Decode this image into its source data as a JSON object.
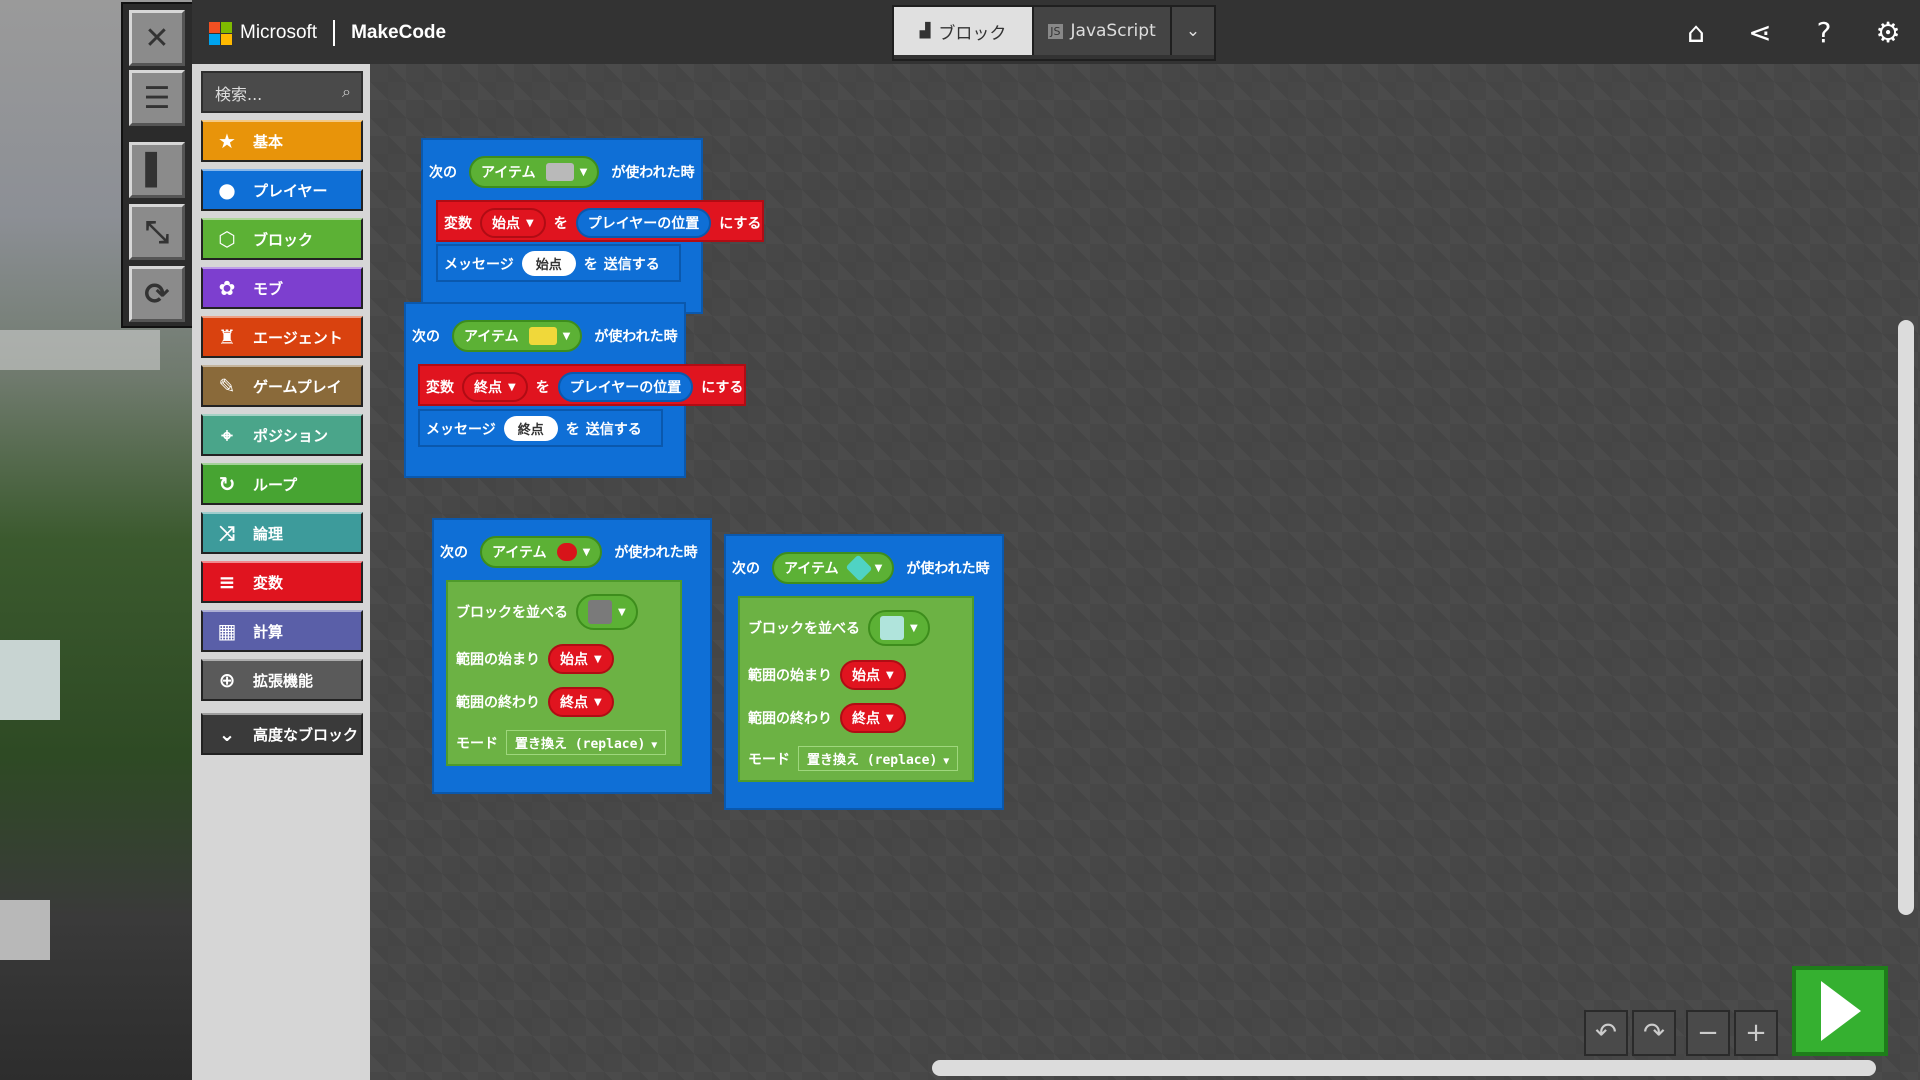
{
  "topbar": {
    "brand": "Microsoft",
    "product": "MakeCode",
    "mode_blocks": "ブロック",
    "mode_js": "JavaScript",
    "icons": [
      "home-icon",
      "share-icon",
      "help-icon",
      "settings-icon"
    ]
  },
  "toolbox": {
    "search_placeholder": "検索...",
    "categories": [
      {
        "label": "基本",
        "color": "#e8940a",
        "icon": "star-icon"
      },
      {
        "label": "プレイヤー",
        "color": "#0f6fd6",
        "icon": "player-icon"
      },
      {
        "label": "ブロック",
        "color": "#5cb135",
        "icon": "cube-icon"
      },
      {
        "label": "モブ",
        "color": "#7d3fcf",
        "icon": "paw-icon"
      },
      {
        "label": "エージェント",
        "color": "#d9420f",
        "icon": "agent-icon"
      },
      {
        "label": "ゲームプレイ",
        "color": "#8a6a3a",
        "icon": "wrench-icon"
      },
      {
        "label": "ポジション",
        "color": "#4aa58a",
        "icon": "crosshair-icon"
      },
      {
        "label": "ループ",
        "color": "#47a432",
        "icon": "loop-icon"
      },
      {
        "label": "論理",
        "color": "#3d9b9b",
        "icon": "shuffle-icon"
      },
      {
        "label": "変数",
        "color": "#e0141f",
        "icon": "list-icon"
      },
      {
        "label": "計算",
        "color": "#5a5fa8",
        "icon": "calculator-icon"
      },
      {
        "label": "拡張機能",
        "color": "#5a5a5a",
        "icon": "plus-circle-icon"
      },
      {
        "label": "高度なブロック",
        "color": "#3a3a3a",
        "icon": "chevron-down-icon"
      }
    ]
  },
  "blocks": {
    "on_item_prefix": "次の",
    "item_label": "アイテム",
    "on_item_suffix": "が使われた時",
    "var_label": "変数",
    "wo": "を",
    "player_pos": "プレイヤーの位置",
    "ni_suru": "にする",
    "message": "メッセージ",
    "send": "送信する",
    "start": "始点",
    "end": "終点",
    "fill": "ブロックを並べる",
    "range_start": "範囲の始まり",
    "range_end": "範囲の終わり",
    "mode": "モード",
    "replace": "置き換え (replace)"
  },
  "colors": {
    "loops_blue": "#0f6fd6",
    "variables_red": "#e0141f",
    "blocks_green": "#5cb135",
    "run_green": "#35b030"
  }
}
